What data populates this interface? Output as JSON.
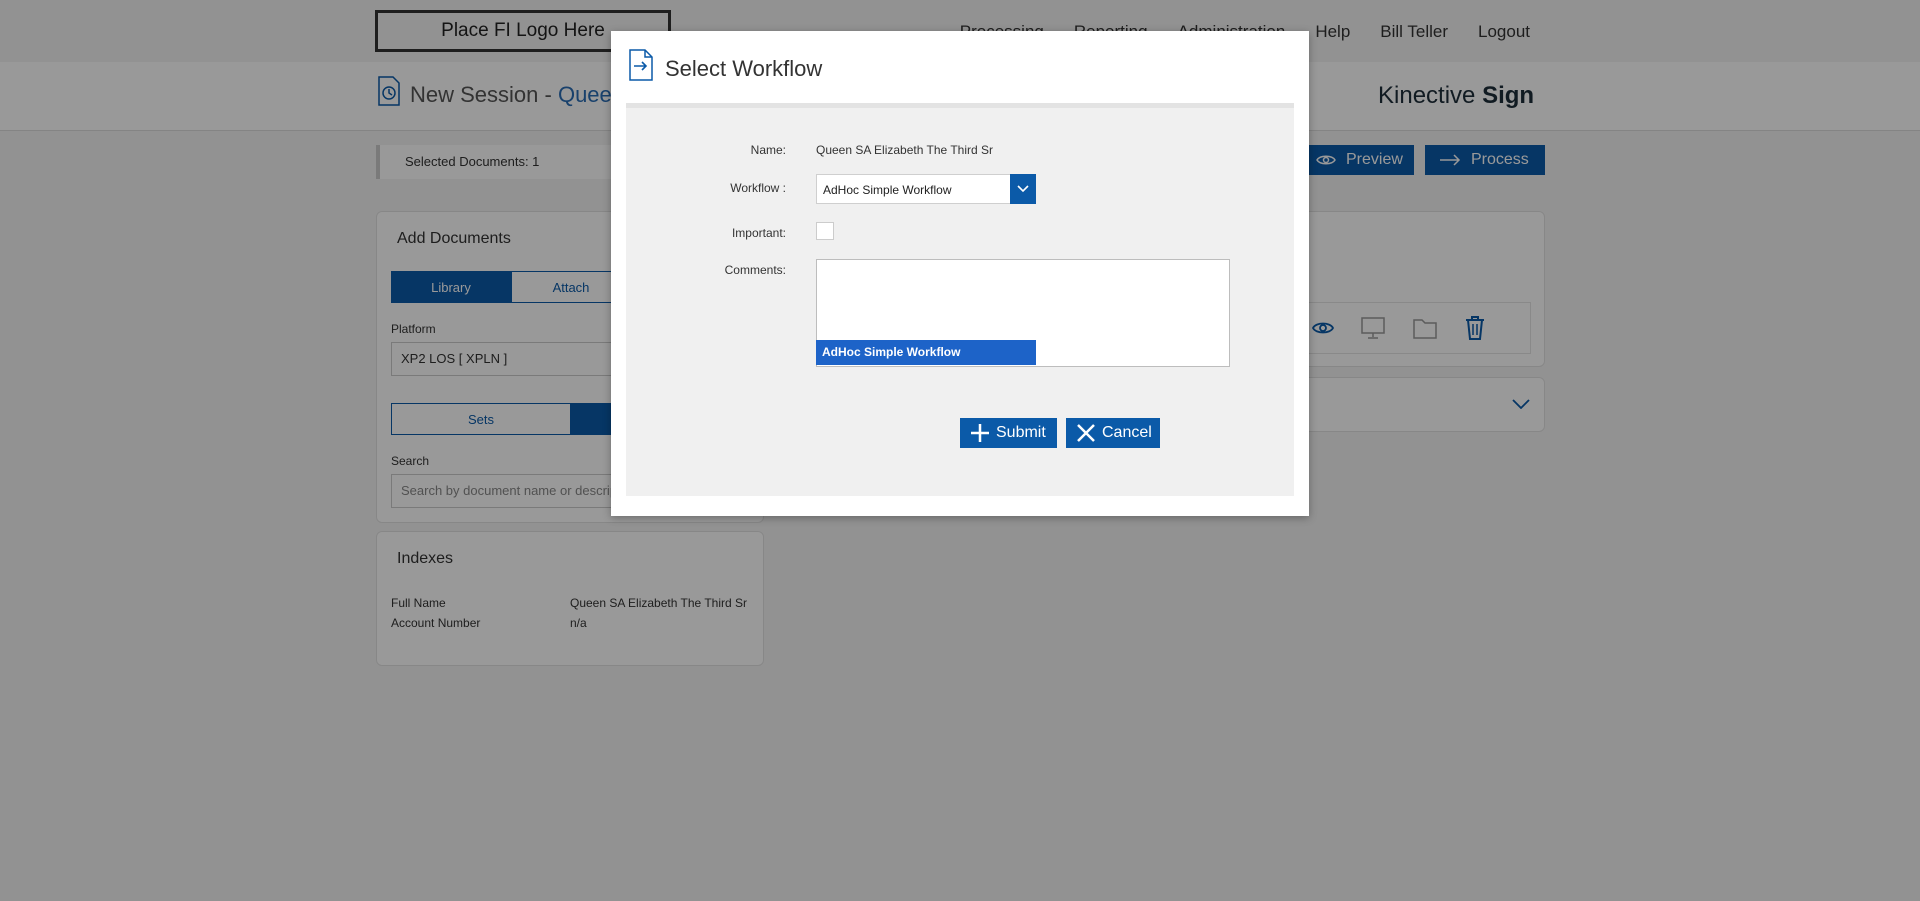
{
  "header": {
    "logo_text": "Place FI Logo Here",
    "nav": [
      "Processing",
      "Reporting",
      "Administration",
      "Help",
      "Bill Teller",
      "Logout"
    ]
  },
  "session": {
    "title_prefix": "New Session - ",
    "customer": "Queen SA Elizabeth The Third Sr",
    "brand_light": "Kinective ",
    "brand_bold": "Sign"
  },
  "toolbar": {
    "selected_documents": "Selected Documents: 1",
    "preview_label": "Preview",
    "process_label": "Process"
  },
  "add_documents": {
    "title": "Add Documents",
    "tabs": [
      "Library",
      "Attach"
    ],
    "platform_label": "Platform",
    "platform_value": "XP2 LOS [ XPLN ]",
    "sub_tabs": [
      "Sets",
      ""
    ],
    "search_label": "Search",
    "search_placeholder": "Search by document name or description"
  },
  "indexes": {
    "title": "Indexes",
    "rows": [
      {
        "label": "Full Name",
        "value": "Queen SA Elizabeth The Third Sr"
      },
      {
        "label": "Account Number",
        "value": "n/a"
      }
    ]
  },
  "modal": {
    "title": "Select Workflow",
    "name_label": "Name:",
    "name_value": "Queen SA Elizabeth The Third Sr",
    "workflow_label": "Workflow :",
    "workflow_value": "AdHoc Simple Workflow",
    "important_label": "Important:",
    "comments_label": "Comments:",
    "dropdown_option": "AdHoc Simple Workflow",
    "submit_label": "Submit",
    "cancel_label": "Cancel"
  },
  "colors": {
    "accent": "#0b5aa8",
    "selected_option": "#1d63c8",
    "overlay": "rgba(0,0,0,0.40)"
  }
}
